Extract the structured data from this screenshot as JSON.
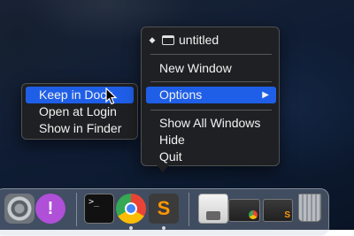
{
  "context_menu": {
    "window_title": "untitled",
    "items": [
      {
        "label": "New Window"
      },
      {
        "label": "Options",
        "has_submenu": true,
        "highlighted": true
      },
      {
        "label": "Show All Windows"
      },
      {
        "label": "Hide"
      },
      {
        "label": "Quit"
      }
    ],
    "submenu_arrow": "▶"
  },
  "options_submenu": {
    "items": [
      {
        "label": "Keep in Dock",
        "highlighted": true
      },
      {
        "label": "Open at Login"
      },
      {
        "label": "Show in Finder"
      }
    ]
  },
  "dock": {
    "apps": [
      {
        "icon": "system-preferences-icon",
        "running": false
      },
      {
        "icon": "feedback-assistant-icon",
        "glyph": "!",
        "running": false
      },
      {
        "icon": "terminal-icon",
        "glyph": ">_",
        "running": false
      },
      {
        "icon": "chrome-icon",
        "running": true
      },
      {
        "icon": "sublime-text-icon",
        "glyph": "S",
        "running": true
      },
      {
        "icon": "preview-icon",
        "running": false
      },
      {
        "icon": "chrome-window-thumbnail-icon",
        "running": false
      },
      {
        "icon": "sublime-window-thumbnail-icon",
        "glyph": "S",
        "running": false
      },
      {
        "icon": "trash-icon",
        "running": false
      }
    ]
  },
  "colors": {
    "highlight": "#1f5fe8",
    "menu_background": "#202022"
  }
}
